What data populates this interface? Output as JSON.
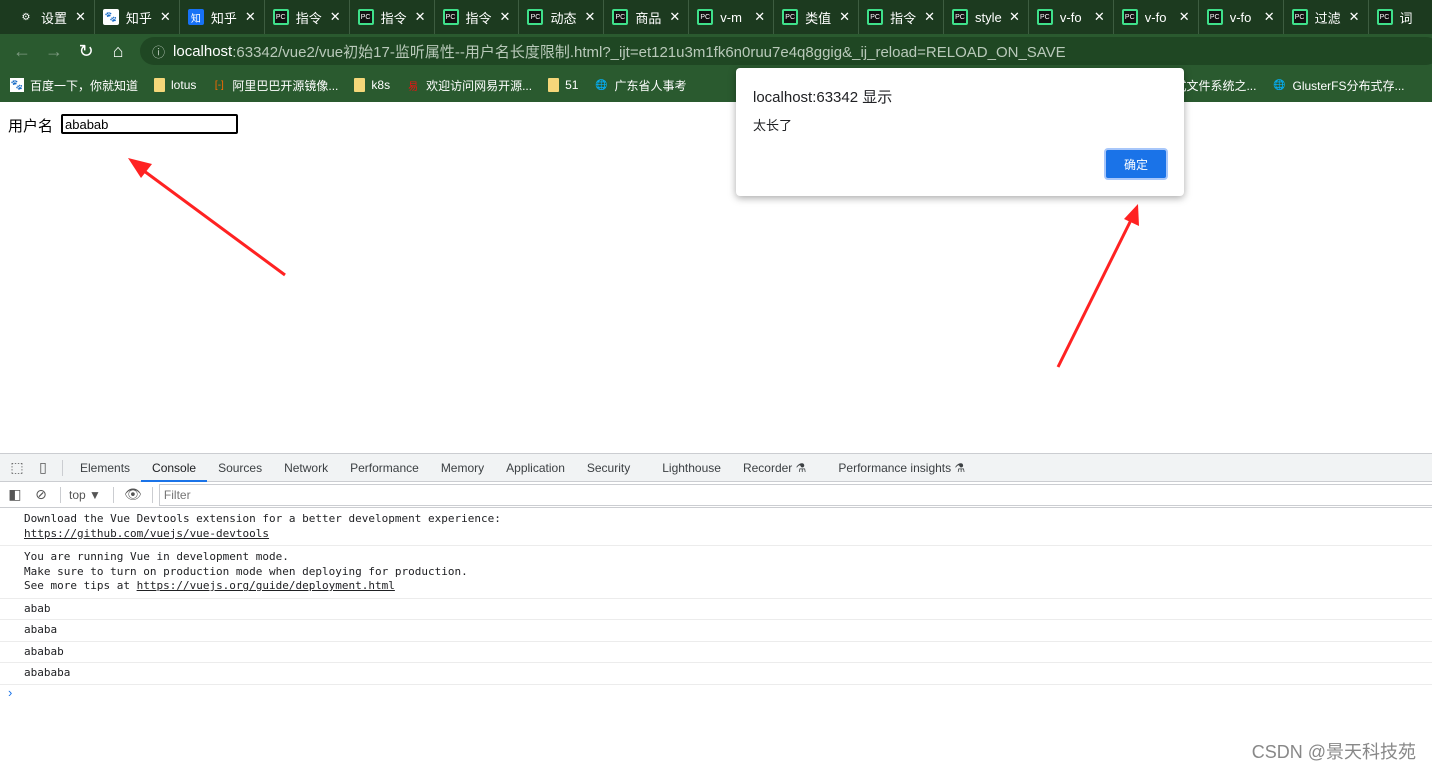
{
  "tabs": [
    {
      "icon": "gear-icon",
      "label": "设置"
    },
    {
      "icon": "baidu-icon",
      "label": "知乎"
    },
    {
      "icon": "zhihu-icon",
      "label": "知乎"
    },
    {
      "icon": "pycharm-icon",
      "label": "指令"
    },
    {
      "icon": "pycharm-icon",
      "label": "指令"
    },
    {
      "icon": "pycharm-icon",
      "label": "指令"
    },
    {
      "icon": "pycharm-icon",
      "label": "动态"
    },
    {
      "icon": "pycharm-icon",
      "label": "商品"
    },
    {
      "icon": "pycharm-icon",
      "label": "v-m"
    },
    {
      "icon": "pycharm-icon",
      "label": "类值"
    },
    {
      "icon": "pycharm-icon",
      "label": "指令"
    },
    {
      "icon": "pycharm-icon",
      "label": "style"
    },
    {
      "icon": "pycharm-icon",
      "label": "v-fo"
    },
    {
      "icon": "pycharm-icon",
      "label": "v-fo"
    },
    {
      "icon": "pycharm-icon",
      "label": "v-fo"
    },
    {
      "icon": "pycharm-icon",
      "label": "过滤"
    },
    {
      "icon": "pycharm-icon",
      "label": "词"
    }
  ],
  "address": {
    "host": "localhost",
    "rest": ":63342/vue2/vue初始17-监听属性--用户名长度限制.html?_ijt=et121u3m1fk6n0ruu7e4q8ggig&_ij_reload=RELOAD_ON_SAVE"
  },
  "bookmarks": [
    {
      "icon": "baidu-icon",
      "label": "百度一下，你就知道"
    },
    {
      "icon": "folder-icon",
      "label": "lotus"
    },
    {
      "icon": "aliyun-icon",
      "label": "阿里巴巴开源镜像..."
    },
    {
      "icon": "folder-icon",
      "label": "k8s"
    },
    {
      "icon": "netease-icon",
      "label": "欢迎访问网易开源..."
    },
    {
      "icon": "folder-icon",
      "label": "51"
    },
    {
      "icon": "globe-icon",
      "label": "广东省人事考"
    },
    {
      "icon": "globe-icon",
      "label": "布式文件系统之..."
    },
    {
      "icon": "globe-icon",
      "label": "GlusterFS分布式存..."
    }
  ],
  "page": {
    "label": "用户名",
    "input_value": "ababab"
  },
  "dialog": {
    "title": "localhost:63342 显示",
    "message": "太长了",
    "ok": "确定"
  },
  "devtools": {
    "tabs": [
      "Elements",
      "Console",
      "Sources",
      "Network",
      "Performance",
      "Memory",
      "Application",
      "Security",
      "Lighthouse",
      "Recorder ⚗",
      "Performance insights ⚗"
    ],
    "active_tab": "Console",
    "context": "top ▼",
    "filter_placeholder": "Filter",
    "messages": {
      "m1": "Download the Vue Devtools extension for a better development experience:",
      "m1_link": "https://github.com/vuejs/vue-devtools",
      "m2a": "You are running Vue in development mode.",
      "m2b": "Make sure to turn on production mode when deploying for production.",
      "m2c": "See more tips at ",
      "m2_link": "https://vuejs.org/guide/deployment.html",
      "logs": [
        "abab",
        "ababa",
        "ababab",
        "abababa"
      ]
    },
    "prompt": "›"
  },
  "watermark": "CSDN @景天科技苑",
  "colors": {
    "arrow": "#f22",
    "accent": "#1a73e8",
    "browser_theme": "#2a5a2f"
  }
}
